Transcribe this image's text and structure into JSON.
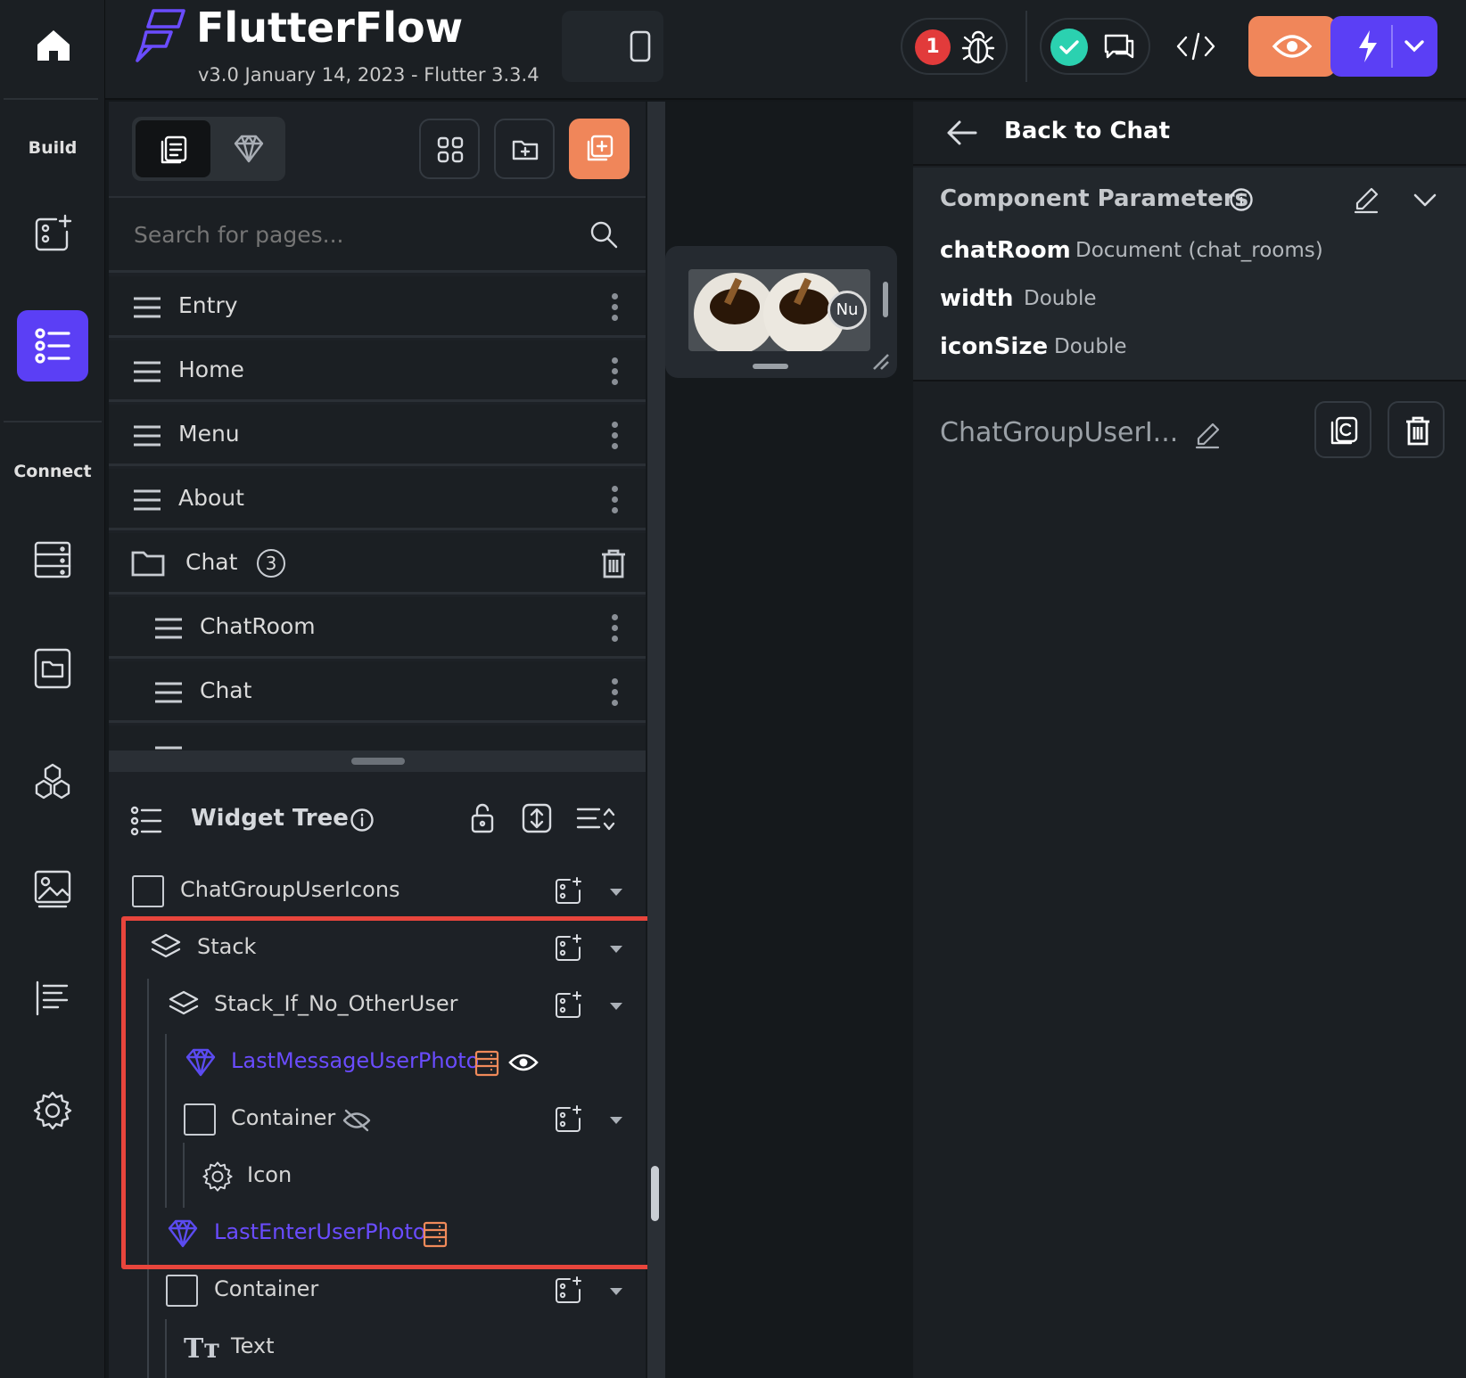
{
  "app": {
    "name": "FlutterFlow",
    "version": "v3.0 January 14, 2023 - Flutter 3.3.4"
  },
  "colors": {
    "accent": "#5b3ff5",
    "orange": "#f0865a",
    "badge_red": "#e23b3b",
    "teal": "#2bd1b0"
  },
  "rail": {
    "build_label": "Build",
    "connect_label": "Connect",
    "icons": [
      "home-icon",
      "add-page-icon",
      "widget-tree-icon",
      "database-icon",
      "storage-icon",
      "api-icon",
      "media-icon",
      "align-icon",
      "settings-icon"
    ]
  },
  "toolbar": {
    "badge_count": "1",
    "icons": [
      "device-phone-icon",
      "bug-icon",
      "check-icon",
      "chat-bubble-icon",
      "code-icon",
      "preview-eye-icon",
      "lightning-icon",
      "chevron-down-icon"
    ]
  },
  "pages": {
    "search_placeholder": "Search for pages...",
    "items": [
      {
        "label": "Entry"
      },
      {
        "label": "Home"
      },
      {
        "label": "Menu"
      },
      {
        "label": "About"
      }
    ],
    "folder": {
      "label": "Chat",
      "count": "3"
    },
    "folder_items": [
      {
        "label": "ChatRoom"
      },
      {
        "label": "Chat"
      }
    ]
  },
  "widget_tree": {
    "title": "Widget Tree",
    "nodes": [
      {
        "label": "ChatGroupUserIcons",
        "type": "container"
      },
      {
        "label": "Stack",
        "type": "stack"
      },
      {
        "label": "Stack_If_No_OtherUser",
        "type": "stack"
      },
      {
        "label": "LastMessageUserPhoto",
        "type": "component"
      },
      {
        "label": "Container",
        "type": "container"
      },
      {
        "label": "Icon",
        "type": "icon"
      },
      {
        "label": "LastEnterUserPhoto",
        "type": "component"
      },
      {
        "label": "Container",
        "type": "container"
      },
      {
        "label": "Text",
        "type": "text"
      }
    ]
  },
  "preview": {
    "avatar_text": "Nu"
  },
  "right_panel": {
    "back_label": "Back to Chat",
    "section_title": "Component Parameters",
    "params": [
      {
        "name": "chatRoom",
        "type": "Document (chat_rooms)"
      },
      {
        "name": "width",
        "type": "Double"
      },
      {
        "name": "iconSize",
        "type": "Double"
      }
    ],
    "component_name": "ChatGroupUserI..."
  }
}
